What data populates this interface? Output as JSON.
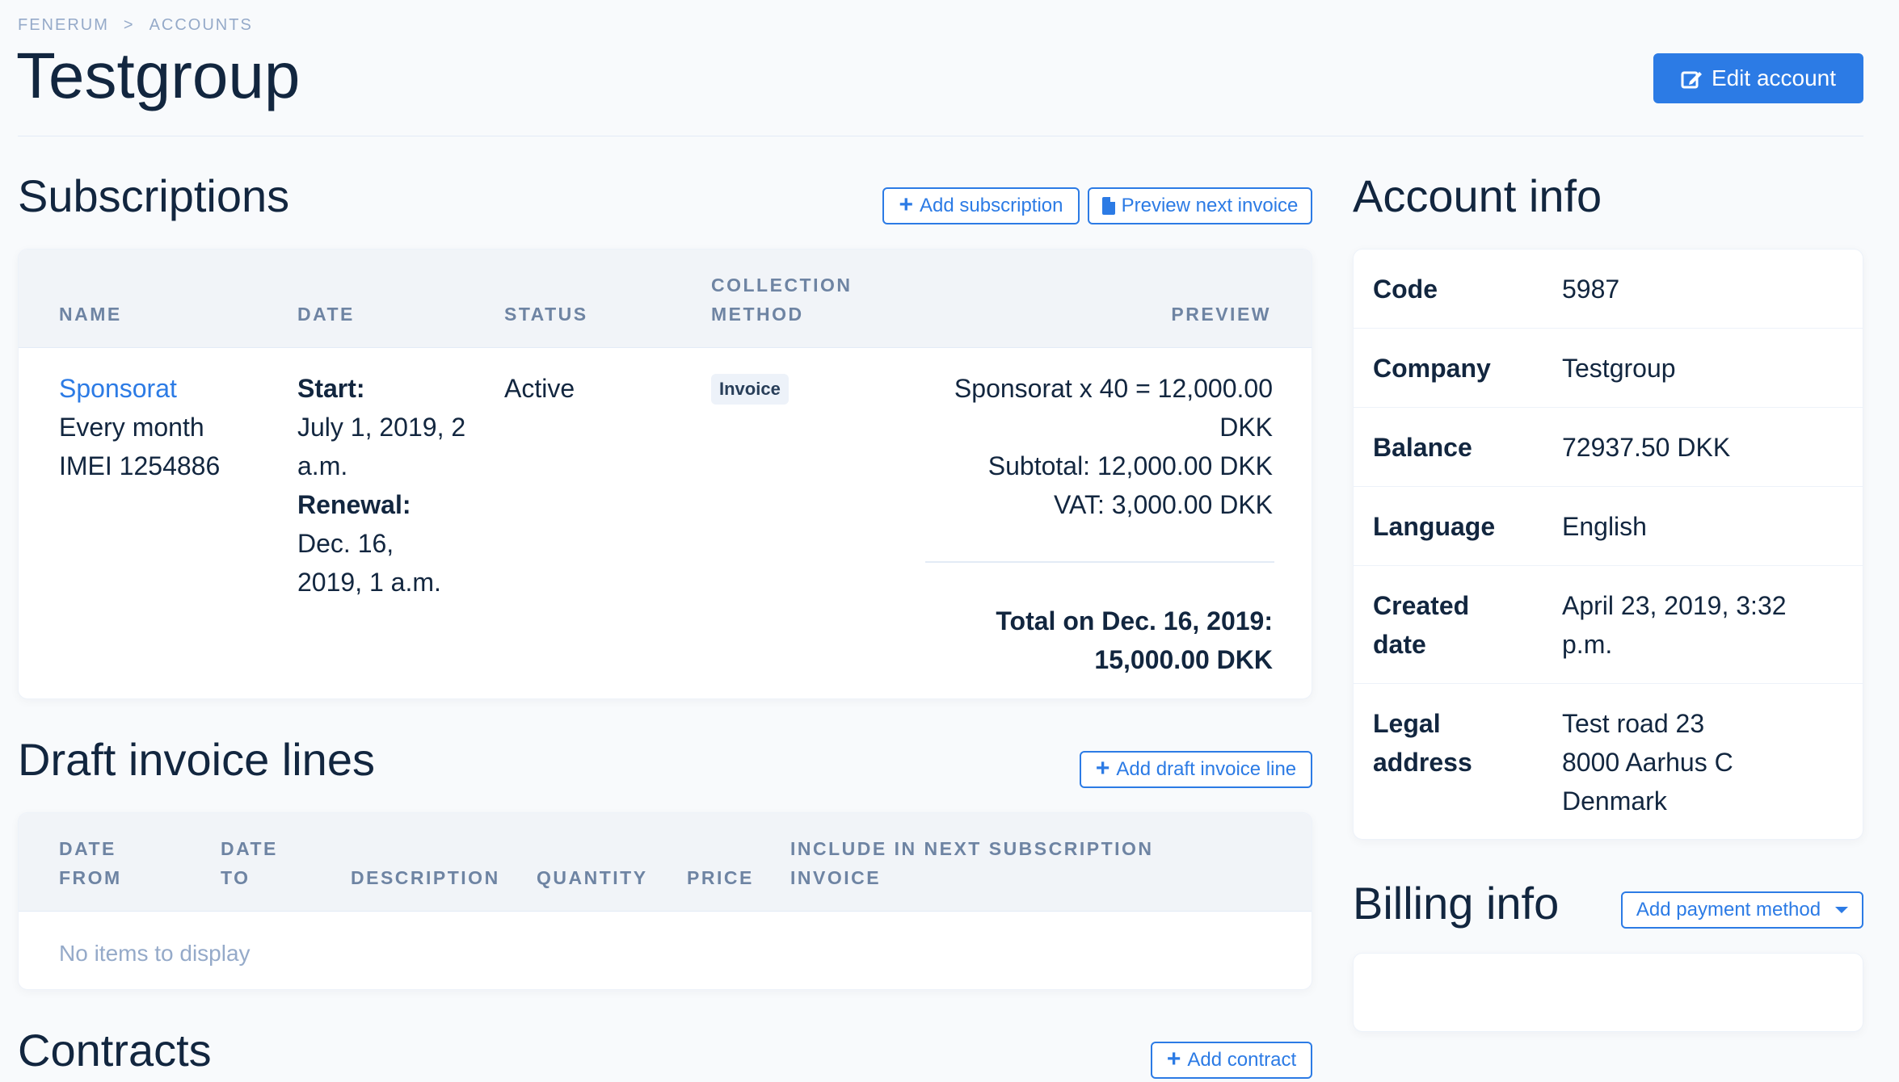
{
  "breadcrumb": {
    "root": "FENERUM",
    "separator": ">",
    "current": "ACCOUNTS"
  },
  "title": "Testgroup",
  "edit_button": "Edit account",
  "subscriptions": {
    "title": "Subscriptions",
    "add_button": "Add subscription",
    "preview_button": "Preview next invoice",
    "columns": [
      "NAME",
      "DATE",
      "STATUS",
      "COLLECTION",
      "METHOD",
      "PREVIEW"
    ],
    "row": {
      "name": "Sponsorat",
      "frequency": "Every month",
      "imei": "IMEI 1254886",
      "start_label": "Start:",
      "start_line1": "July 1, 2019, 2",
      "start_line2": "a.m.",
      "renewal_label": "Renewal:",
      "renewal_line1": "Dec. 16,",
      "renewal_line2": "2019, 1 a.m.",
      "status": "Active",
      "method": "Invoice",
      "preview_line1": "Sponsorat x 40 = 12,000.00",
      "preview_line2": "DKK",
      "subtotal": "Subtotal: 12,000.00 DKK",
      "vat": "VAT: 3,000.00 DKK",
      "total_line1": "Total on Dec. 16, 2019:",
      "total_line2": "15,000.00 DKK"
    }
  },
  "draft": {
    "title": "Draft invoice lines",
    "add_button": "Add draft invoice line",
    "columns": {
      "date_from_1": "DATE",
      "date_from_2": "FROM",
      "date_to_1": "DATE",
      "date_to_2": "TO",
      "description": "DESCRIPTION",
      "quantity": "QUANTITY",
      "price": "PRICE",
      "include_1": "INCLUDE IN NEXT SUBSCRIPTION",
      "include_2": "INVOICE"
    },
    "empty": "No items to display"
  },
  "contracts": {
    "title": "Contracts",
    "add_button": "Add contract"
  },
  "account_info": {
    "title": "Account info",
    "rows": [
      {
        "label": "Code",
        "value": "5987"
      },
      {
        "label": "Company",
        "value": "Testgroup"
      },
      {
        "label": "Balance",
        "value": "72937.50 DKK"
      },
      {
        "label": "Language",
        "value": "English"
      },
      {
        "label_1": "Created",
        "label_2": "date",
        "value_1": "April 23, 2019, 3:32",
        "value_2": "p.m."
      },
      {
        "label_1": "Legal",
        "label_2": "address",
        "value_1": "Test road 23",
        "value_2": "8000 Aarhus C",
        "value_3": "Denmark"
      }
    ]
  },
  "billing_info": {
    "title": "Billing info",
    "add_button": "Add payment method"
  },
  "colors": {
    "primary": "#2c7be5",
    "text": "#12263f",
    "muted": "#95aac9",
    "header_bg": "#f1f4f8"
  }
}
